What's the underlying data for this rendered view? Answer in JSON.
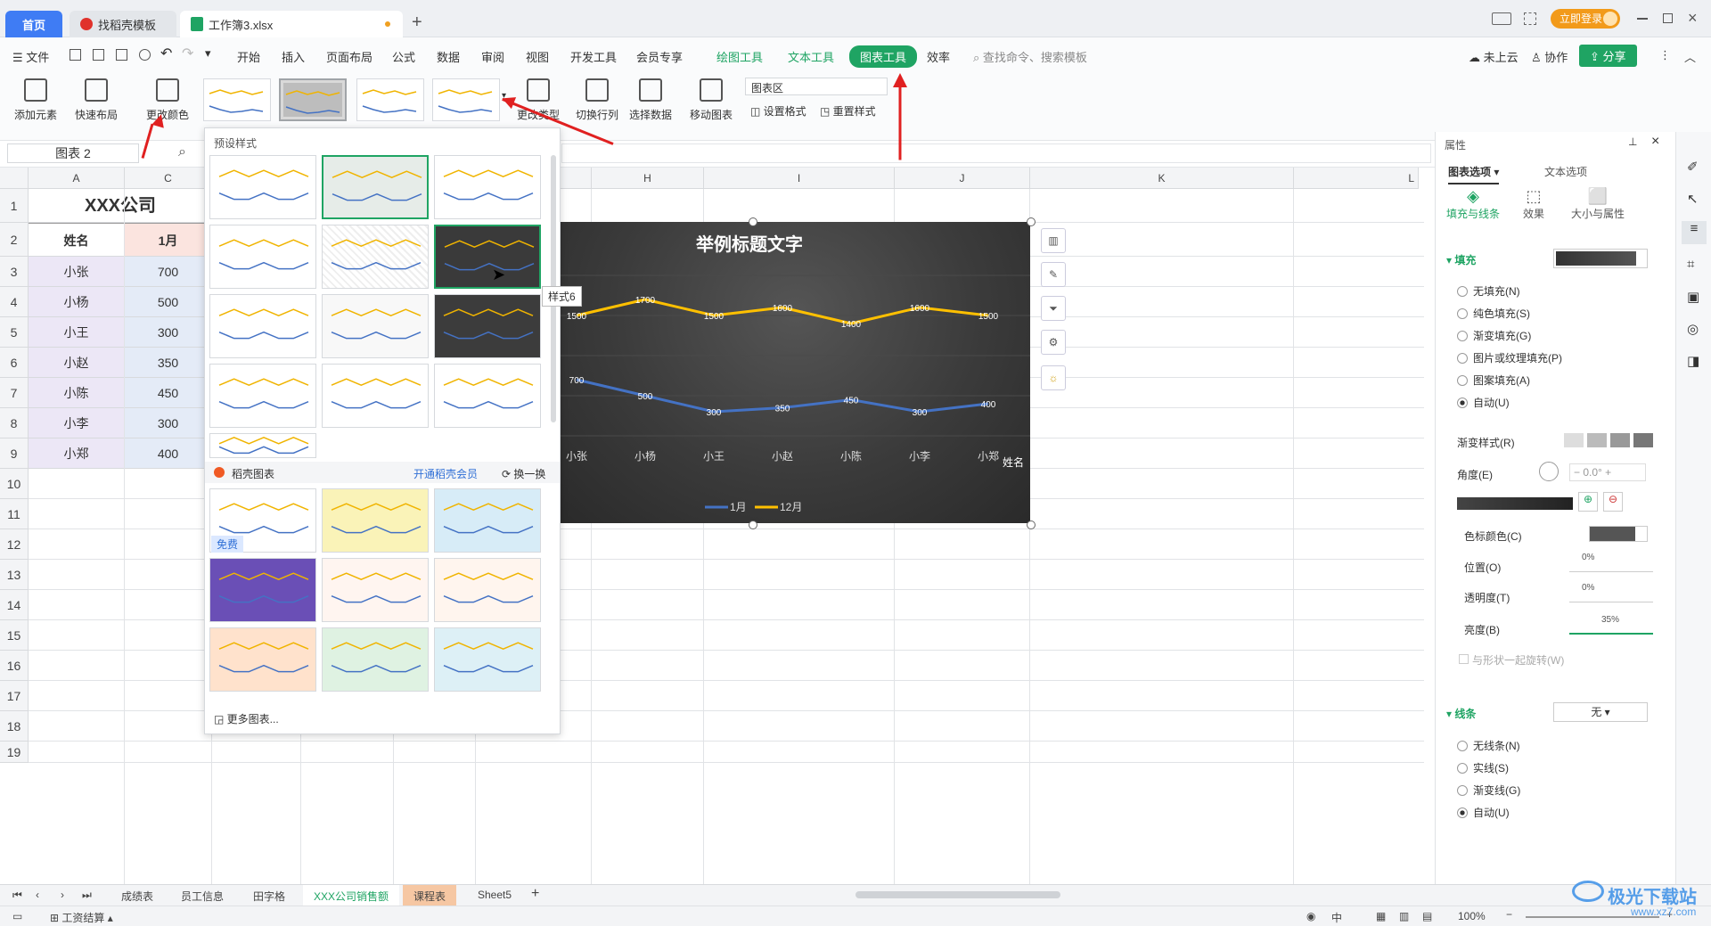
{
  "tabs": {
    "home": "首页",
    "template": "找稻壳模板",
    "file": "工作簿3.xlsx",
    "new": "+",
    "login": "立即登录"
  },
  "menu": {
    "file": "文件",
    "items": [
      "开始",
      "插入",
      "页面布局",
      "公式",
      "数据",
      "审阅",
      "视图",
      "开发工具",
      "会员专享"
    ],
    "draw_tool": "绘图工具",
    "text_tool": "文本工具",
    "chart_tool": "图表工具",
    "efficiency": "效率",
    "search": "查找命令、搜索模板",
    "cloud": "未上云",
    "collab": "协作",
    "share": "分享"
  },
  "ribbon": {
    "add_element": "添加元素",
    "quick_layout": "快速布局",
    "change_color": "更改颜色",
    "change_type": "更改类型",
    "switch_rowcol": "切换行列",
    "select_data": "选择数据",
    "move_chart": "移动图表",
    "chart_area": "图表区",
    "set_format": "设置格式",
    "reset_style": "重置样式"
  },
  "namebox": "图表 2",
  "columns": [
    "A",
    "C",
    "H",
    "I",
    "J",
    "K",
    "L"
  ],
  "rows": [
    "1",
    "2",
    "3",
    "4",
    "5",
    "6",
    "7",
    "8",
    "9",
    "10",
    "11",
    "12",
    "13",
    "14",
    "15",
    "16",
    "17",
    "18",
    "19"
  ],
  "sheet": {
    "title": "XXX公司",
    "header_name": "姓名",
    "header_jan": "1月",
    "names": [
      "小张",
      "小杨",
      "小王",
      "小赵",
      "小陈",
      "小李",
      "小郑"
    ],
    "jan": [
      "700",
      "500",
      "300",
      "350",
      "450",
      "300",
      "400"
    ]
  },
  "gallery": {
    "preset_label": "预设样式",
    "docer_label": "稻壳图表",
    "vip_link": "开通稻壳会员",
    "refresh": "换一换",
    "free_badge": "免费",
    "more_charts": "更多图表...",
    "tooltip": "样式6"
  },
  "chart_data": {
    "type": "line",
    "title": "举例标题文字",
    "categories": [
      "小张",
      "小杨",
      "小王",
      "小赵",
      "小陈",
      "小李",
      "小郑"
    ],
    "xlabel": "姓名",
    "ylim": [
      0,
      2000
    ],
    "series": [
      {
        "name": "1月",
        "values": [
          700,
          500,
          300,
          350,
          450,
          300,
          400
        ],
        "color": "#4472c4"
      },
      {
        "name": "12月",
        "values": [
          1500,
          1700,
          1500,
          1600,
          1400,
          1600,
          1500
        ],
        "color": "#ffc000"
      }
    ],
    "legend": "bottom",
    "background": "dark-gradient"
  },
  "panel": {
    "title": "属性",
    "tab_chart": "图表选项",
    "tab_text": "文本选项",
    "sub_fill": "填充与线条",
    "sub_effect": "效果",
    "sub_size": "大小与属性",
    "fill_head": "填充",
    "fill_options": [
      "无填充(N)",
      "纯色填充(S)",
      "渐变填充(G)",
      "图片或纹理填充(P)",
      "图案填充(A)",
      "自动(U)"
    ],
    "gradient_style": "渐变样式(R)",
    "angle": "角度(E)",
    "angle_value": "0.0°",
    "stop_color": "色标颜色(C)",
    "position": "位置(O)",
    "position_value": "0%",
    "transparency": "透明度(T)",
    "transparency_value": "0%",
    "brightness": "亮度(B)",
    "brightness_value": "35%",
    "rotate": "与形状一起旋转(W)",
    "line_head": "线条",
    "line_value": "无",
    "line_options": [
      "无线条(N)",
      "实线(S)",
      "渐变线(G)",
      "自动(U)"
    ]
  },
  "sheettabs": [
    "成绩表",
    "员工信息",
    "田字格",
    "XXX公司销售额",
    "课程表",
    "Sheet5"
  ],
  "status": {
    "left": "工资结算",
    "zoom": "100%"
  },
  "watermark": "极光下载站",
  "watermark_url": "www.xz7.com"
}
